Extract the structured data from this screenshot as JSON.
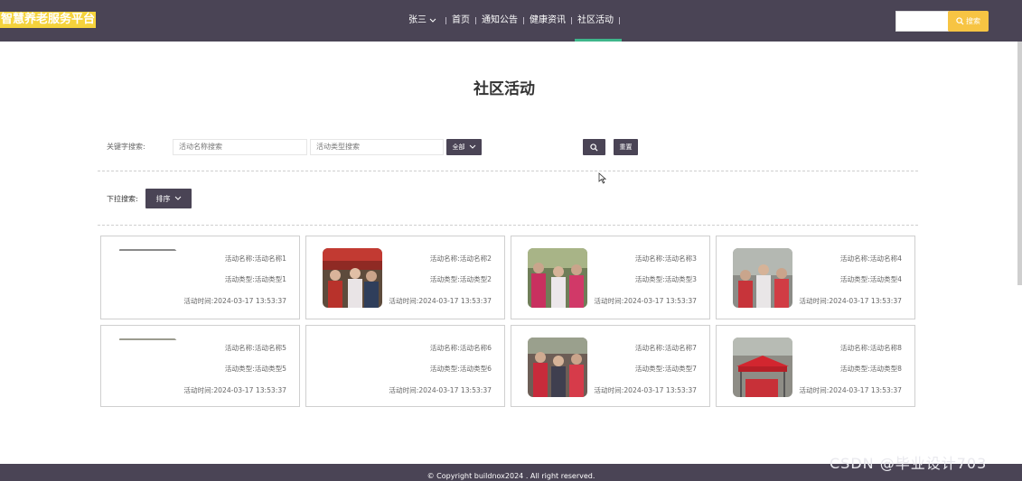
{
  "header": {
    "brand": "智慧养老服务平台",
    "user": "张三",
    "nav": [
      "首页",
      "通知公告",
      "健康资讯",
      "社区活动"
    ],
    "search_button": "搜索"
  },
  "page": {
    "title": "社区活动",
    "keyword_label": "关键字搜索:",
    "name_placeholder": "活动名称搜索",
    "type_placeholder": "活动类型搜索",
    "all_label": "全部",
    "reset_label": "重置",
    "dropdown_label": "下拉搜索:",
    "sort_label": "排序"
  },
  "cards": [
    {
      "name": "活动名称:活动名称1",
      "type": "活动类型:活动类型1",
      "time": "活动时间:2024-03-17 13:53:37"
    },
    {
      "name": "活动名称:活动名称2",
      "type": "活动类型:活动类型2",
      "time": "活动时间:2024-03-17 13:53:37"
    },
    {
      "name": "活动名称:活动名称3",
      "type": "活动类型:活动类型3",
      "time": "活动时间:2024-03-17 13:53:37"
    },
    {
      "name": "活动名称:活动名称4",
      "type": "活动类型:活动类型4",
      "time": "活动时间:2024-03-17 13:53:37"
    },
    {
      "name": "活动名称:活动名称5",
      "type": "活动类型:活动类型5",
      "time": "活动时间:2024-03-17 13:53:37"
    },
    {
      "name": "活动名称:活动名称6",
      "type": "活动类型:活动类型6",
      "time": "活动时间:2024-03-17 13:53:37"
    },
    {
      "name": "活动名称:活动名称7",
      "type": "活动类型:活动类型7",
      "time": "活动时间:2024-03-17 13:53:37"
    },
    {
      "name": "活动名称:活动名称8",
      "type": "活动类型:活动类型8",
      "time": "活动时间:2024-03-17 13:53:37"
    }
  ],
  "footer": {
    "copyright": "© Copyright buildnox2024 . All right reserved."
  },
  "watermark": "CSDN @毕业设计703",
  "colors": {
    "primary": "#4a4455",
    "accent": "#f7c443",
    "active": "#3fb68b"
  }
}
